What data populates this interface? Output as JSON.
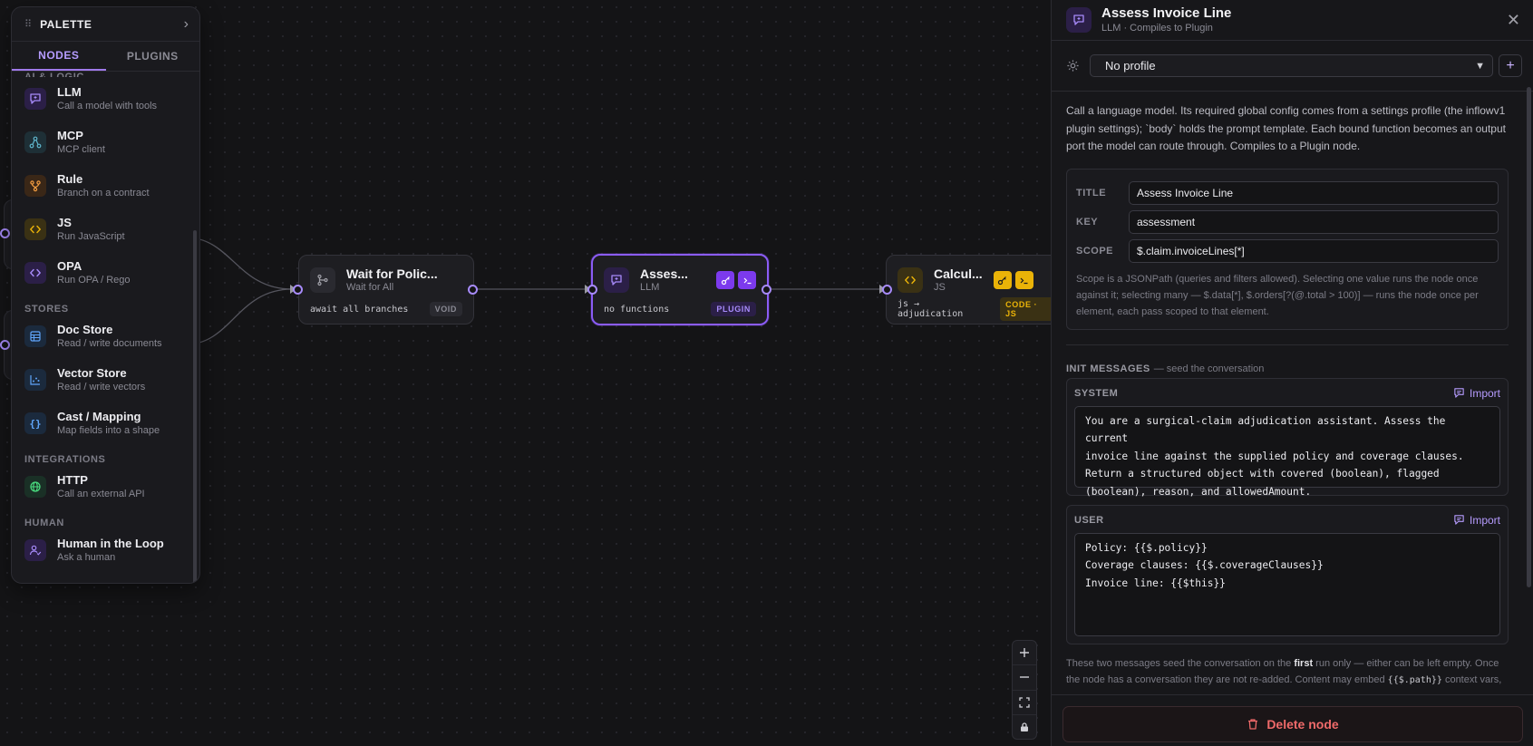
{
  "palette": {
    "title": "PALETTE",
    "tabs": [
      "NODES",
      "PLUGINS"
    ],
    "sections": {
      "ai_logic": "AI & LOGIC",
      "stores": "STORES",
      "integrations": "INTEGRATIONS",
      "human": "HUMAN"
    },
    "items": {
      "llm": {
        "name": "LLM",
        "desc": "Call a model with tools",
        "icon": "chat-icon"
      },
      "mcp": {
        "name": "MCP",
        "desc": "MCP client",
        "icon": "nodes-icon"
      },
      "rule": {
        "name": "Rule",
        "desc": "Branch on a contract",
        "icon": "branch-icon"
      },
      "js": {
        "name": "JS",
        "desc": "Run JavaScript",
        "icon": "code-icon"
      },
      "opa": {
        "name": "OPA",
        "desc": "Run OPA / Rego",
        "icon": "code-icon"
      },
      "doc_store": {
        "name": "Doc Store",
        "desc": "Read / write documents",
        "icon": "table-icon"
      },
      "vector_store": {
        "name": "Vector Store",
        "desc": "Read / write vectors",
        "icon": "scatter-icon"
      },
      "cast": {
        "name": "Cast / Mapping",
        "desc": "Map fields into a shape",
        "icon": "braces-icon"
      },
      "http": {
        "name": "HTTP",
        "desc": "Call an external API",
        "icon": "globe-icon"
      },
      "hitl": {
        "name": "Human in the Loop",
        "desc": "Ask a human",
        "icon": "user-check-icon"
      }
    }
  },
  "nodes": {
    "wait": {
      "title": "Wait for Polic...",
      "subtitle": "Wait for All",
      "code": "await all branches",
      "tag": "VOID"
    },
    "assess": {
      "title": "Asses...",
      "subtitle": "LLM",
      "code": "no functions",
      "tag": "PLUGIN"
    },
    "calc": {
      "title": "Calcul...",
      "subtitle": "JS",
      "code": "js → adjudication",
      "tag": "CODE · JS"
    }
  },
  "panel": {
    "title": "Assess Invoice Line",
    "subtitle": "LLM · Compiles to Plugin",
    "profile": "No profile",
    "description": "Call a language model. Its required global config comes from a settings profile (the inflowv1 plugin settings); `body` holds the prompt template. Each bound function becomes an output port the model can route through. Compiles to a Plugin node.",
    "fields": {
      "title_label": "TITLE",
      "title_value": "Assess Invoice Line",
      "key_label": "KEY",
      "key_value": "assessment",
      "scope_label": "SCOPE",
      "scope_value": "$.claim.invoiceLines[*]",
      "scope_help": "Scope is a JSONPath (queries and filters allowed). Selecting one value runs the node once against it; selecting many — $.data[*], $.orders[?(@.total > 100)] — runs the node once per element, each pass scoped to that element."
    },
    "init_messages": {
      "heading": "INIT MESSAGES",
      "subheading": "— seed the conversation",
      "import_label": "Import",
      "system_role": "SYSTEM",
      "system_text": "You are a surgical-claim adjudication assistant. Assess the current\ninvoice line against the supplied policy and coverage clauses.\nReturn a structured object with covered (boolean), flagged\n(boolean), reason, and allowedAmount.",
      "user_role": "USER",
      "user_text": "Policy: {{$.policy}}\nCoverage clauses: {{$.coverageClauses}}\nInvoice line: {{$this}}"
    },
    "footnote_a": "These two messages seed the conversation on the ",
    "footnote_b": "first",
    "footnote_c": " run only — either can be left empty. Once the node has a conversation they are not re-added. Content may embed ",
    "footnote_code": "{{$.path}}",
    "footnote_d": " context vars,",
    "delete_label": "Delete node"
  },
  "colors": {
    "accent": "#8b5cf6",
    "danger": "#f06a6a",
    "js_yellow": "#eab308"
  }
}
